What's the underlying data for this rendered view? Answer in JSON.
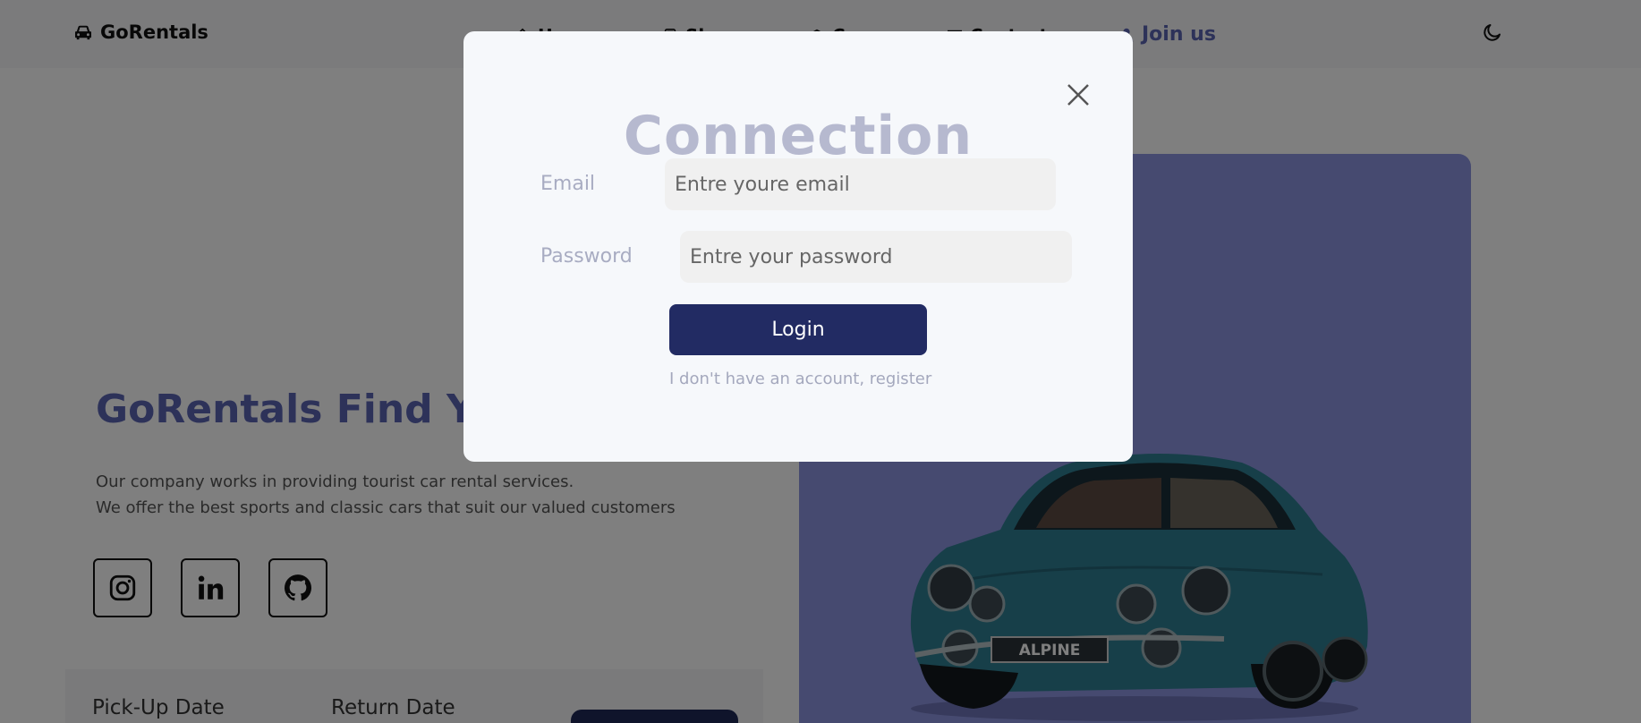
{
  "navbar": {
    "brand": "GoRentals",
    "brand_icon": "car-icon",
    "items": [
      {
        "label": "Home",
        "icon": "home-icon"
      },
      {
        "label": "Shop",
        "icon": "phone-icon"
      },
      {
        "label": "Courses",
        "icon": "graduation-cap-icon"
      },
      {
        "label": "Contact",
        "icon": "envelope-icon"
      }
    ],
    "join_label": "Join us",
    "join_icon": "user-icon",
    "theme_icon": "moon-icon"
  },
  "hero": {
    "title": "GoRentals Find You",
    "desc_line1": "Our company works in providing tourist car rental services.",
    "desc_line2": "We offer the best sports and classic cars that suit our valued customers"
  },
  "social": [
    "instagram-icon",
    "linkedin-icon",
    "github-icon"
  ],
  "booking": {
    "pickup_label": "Pick-Up Date",
    "return_label": "Return Date"
  },
  "car": {
    "plate_text": "ALPINE"
  },
  "modal": {
    "title": "Connection",
    "email_label": "Email",
    "email_placeholder": "Entre youre email",
    "password_label": "Password",
    "password_placeholder": "Entre your password",
    "login_label": "Login",
    "register_text": "I don't have an account, register"
  },
  "colors": {
    "accent": "#5b64b3",
    "button_dark": "#222b63",
    "hero_panel": "#8d95e0",
    "overlay": "rgba(0,0,0,0.5)"
  }
}
